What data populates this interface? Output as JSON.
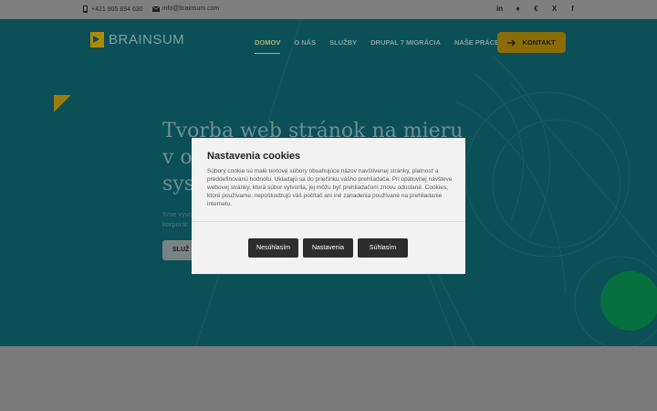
{
  "topbar": {
    "phone": "+421 905 894 630",
    "email": "info@brainsum.com",
    "social": [
      {
        "name": "linkedin-icon",
        "glyph": "in"
      },
      {
        "name": "drupal-icon",
        "glyph": "♦"
      },
      {
        "name": "euro-icon",
        "glyph": "€"
      },
      {
        "name": "x-icon",
        "glyph": "X"
      },
      {
        "name": "facebook-icon",
        "glyph": "f"
      }
    ]
  },
  "header": {
    "logo": "BRAINSUM",
    "nav": [
      "DOMOV",
      "O NÁS",
      "SLUŽBY",
      "DRUPAL 7 MIGRÁCIA",
      "NAŠE PRÁCE"
    ],
    "active_nav": "DOMOV",
    "cta": "KONTAKT"
  },
  "hero": {
    "headline_lines": [
      "Tvorba web stránok na mieru",
      "v o",
      "sys"
    ],
    "sub_lines": [
      "Sme vývo",
      "korporát"
    ],
    "button": "SLUŽ"
  },
  "cookie_modal": {
    "title": "Nastavenia cookies",
    "text": "Súbory cookie sú malé textové súbory obsahujúce názov navštívenej stránky, platnosť a preddefinovanú hodnotu. Ukladajú sa do priečinku vášho prehliadača. Pri opätovnej návšteve webovej stránky, ktorá súbor vytvorila, jej môžu byť prehliadačom znovu odoslané. Cookies, ktoré používame, nepoškodzujú váš počítač ani iné zariadenia používané na prehliadanie internetu.",
    "buttons": {
      "decline": "Nesúhlasím",
      "settings": "Nastavenia",
      "accept": "Súhlasím"
    }
  },
  "colors": {
    "hero_bg": "#0b4f57",
    "accent": "#b08a05",
    "green": "#06703f"
  }
}
